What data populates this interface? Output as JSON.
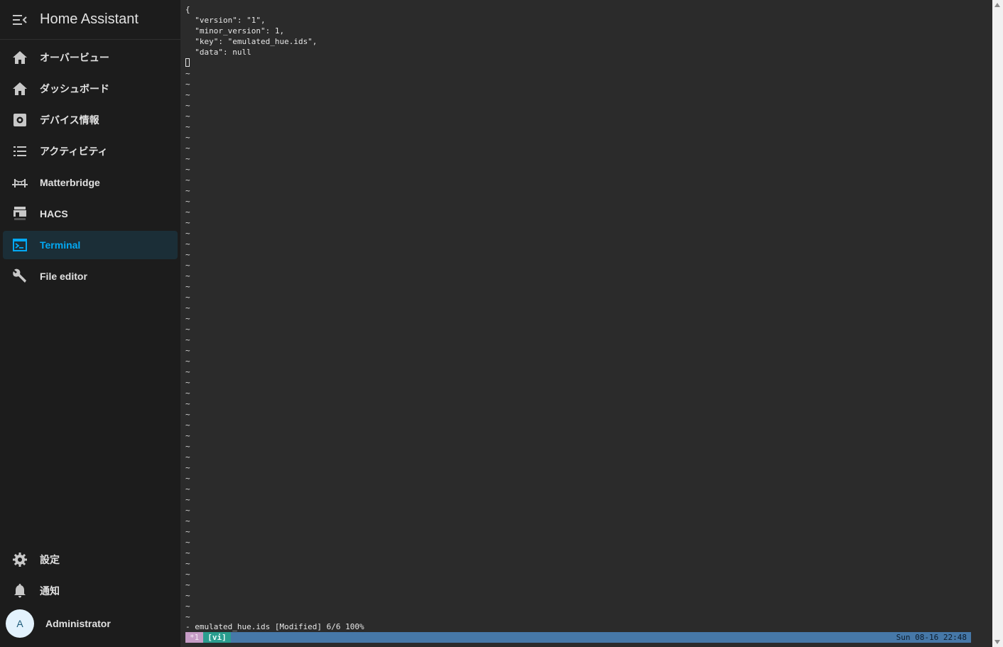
{
  "app": {
    "title": "Home Assistant"
  },
  "sidebar": {
    "items": [
      {
        "label": "オーバービュー",
        "icon": "home-icon"
      },
      {
        "label": "ダッシュボード",
        "icon": "home-icon"
      },
      {
        "label": "デバイス情報",
        "icon": "settings-box-icon"
      },
      {
        "label": "アクティビティ",
        "icon": "format-list-icon"
      },
      {
        "label": "Matterbridge",
        "icon": "bridge-icon"
      },
      {
        "label": "HACS",
        "icon": "hacs-icon"
      },
      {
        "label": "Terminal",
        "icon": "console-icon",
        "active": true
      },
      {
        "label": "File editor",
        "icon": "wrench-icon"
      }
    ],
    "bottom": {
      "settings_label": "設定",
      "notifications_label": "通知",
      "user": {
        "initial": "A",
        "name": "Administrator"
      }
    }
  },
  "terminal": {
    "lines": [
      "{",
      "  \"version\": \"1\",",
      "  \"minor_version\": 1,",
      "  \"key\": \"emulated_hue.ids\",",
      "  \"data\": null"
    ],
    "tilde_count": 52,
    "vim_status": "- emulated_hue.ids [Modified] 6/6 100%",
    "tmux": {
      "window": "*1",
      "mode": "[vi]",
      "clock": "Sun 08-16 22:48"
    }
  },
  "colors": {
    "accent": "#03a9f4",
    "sidebar_bg": "#1c1c1c",
    "terminal_bg": "#2b2b2b",
    "tmux_bar": "#4678a8",
    "tmux_window": "#c69cc6",
    "tmux_mode": "#2a9d8f"
  }
}
